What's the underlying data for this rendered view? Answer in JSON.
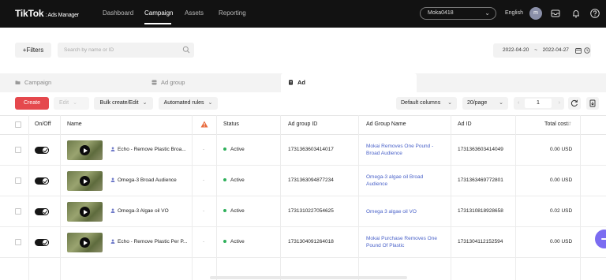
{
  "topbar": {
    "logo": "TikTok",
    "logo_sub": ": Ads Manager",
    "nav": [
      "Dashboard",
      "Campaign",
      "Assets",
      "Reporting"
    ],
    "account": "Moka0418",
    "language": "English",
    "avatar_initial": "m"
  },
  "filters": {
    "filters_label": "+Filters",
    "search_placeholder": "Search by name or ID",
    "date_start": "2022-04-20",
    "date_sep": "~",
    "date_end": "2022-04-27"
  },
  "tabs": [
    "Campaign",
    "Ad group",
    "Ad"
  ],
  "toolbar": {
    "create": "Create",
    "edit": "Edit",
    "bulk": "Bulk create/Edit",
    "rules": "Automated rules",
    "columns": "Default columns",
    "per_page": "20/page",
    "page": "1"
  },
  "table": {
    "headers": {
      "onoff": "On/Off",
      "name": "Name",
      "status": "Status",
      "adgroup_id": "Ad group ID",
      "adgroup_name": "Ad Group Name",
      "ad_id": "Ad ID",
      "total_cost": "Total cost"
    },
    "rows": [
      {
        "name": "Echo - Remove Plastic Broa...",
        "dash": "-",
        "status": "Active",
        "adgroup_id": "1731363603414017",
        "adgroup_name": "Mokai Removes One Pound - Broad Audience",
        "ad_id": "1731363603414049",
        "cost": "0.00 USD"
      },
      {
        "name": "Omega-3 Broad Audience",
        "dash": "-",
        "status": "Active",
        "adgroup_id": "1731363094877234",
        "adgroup_name": "Omega-3 algae oil Broad Audience",
        "ad_id": "1731363469772801",
        "cost": "0.00 USD"
      },
      {
        "name": "Omega-3 Algae oil VO",
        "dash": "-",
        "status": "Active",
        "adgroup_id": "1731310227054625",
        "adgroup_name": "Omega 3 algae oil VO",
        "ad_id": "1731310818928658",
        "cost": "0.02 USD"
      },
      {
        "name": "Echo - Remove Plastic Per P...",
        "dash": "-",
        "status": "Active",
        "adgroup_id": "1731304091264018",
        "adgroup_name": "Mokai Purchase Removes One Pound Of Plastic",
        "ad_id": "1731304112152594",
        "cost": "0.00 USD"
      }
    ]
  },
  "colors": {
    "topbar_bg": "#121212",
    "create_button": "#e5484d",
    "active_status": "#2fb05b",
    "link": "#4b63c9",
    "chat": "#7b6cf1"
  }
}
